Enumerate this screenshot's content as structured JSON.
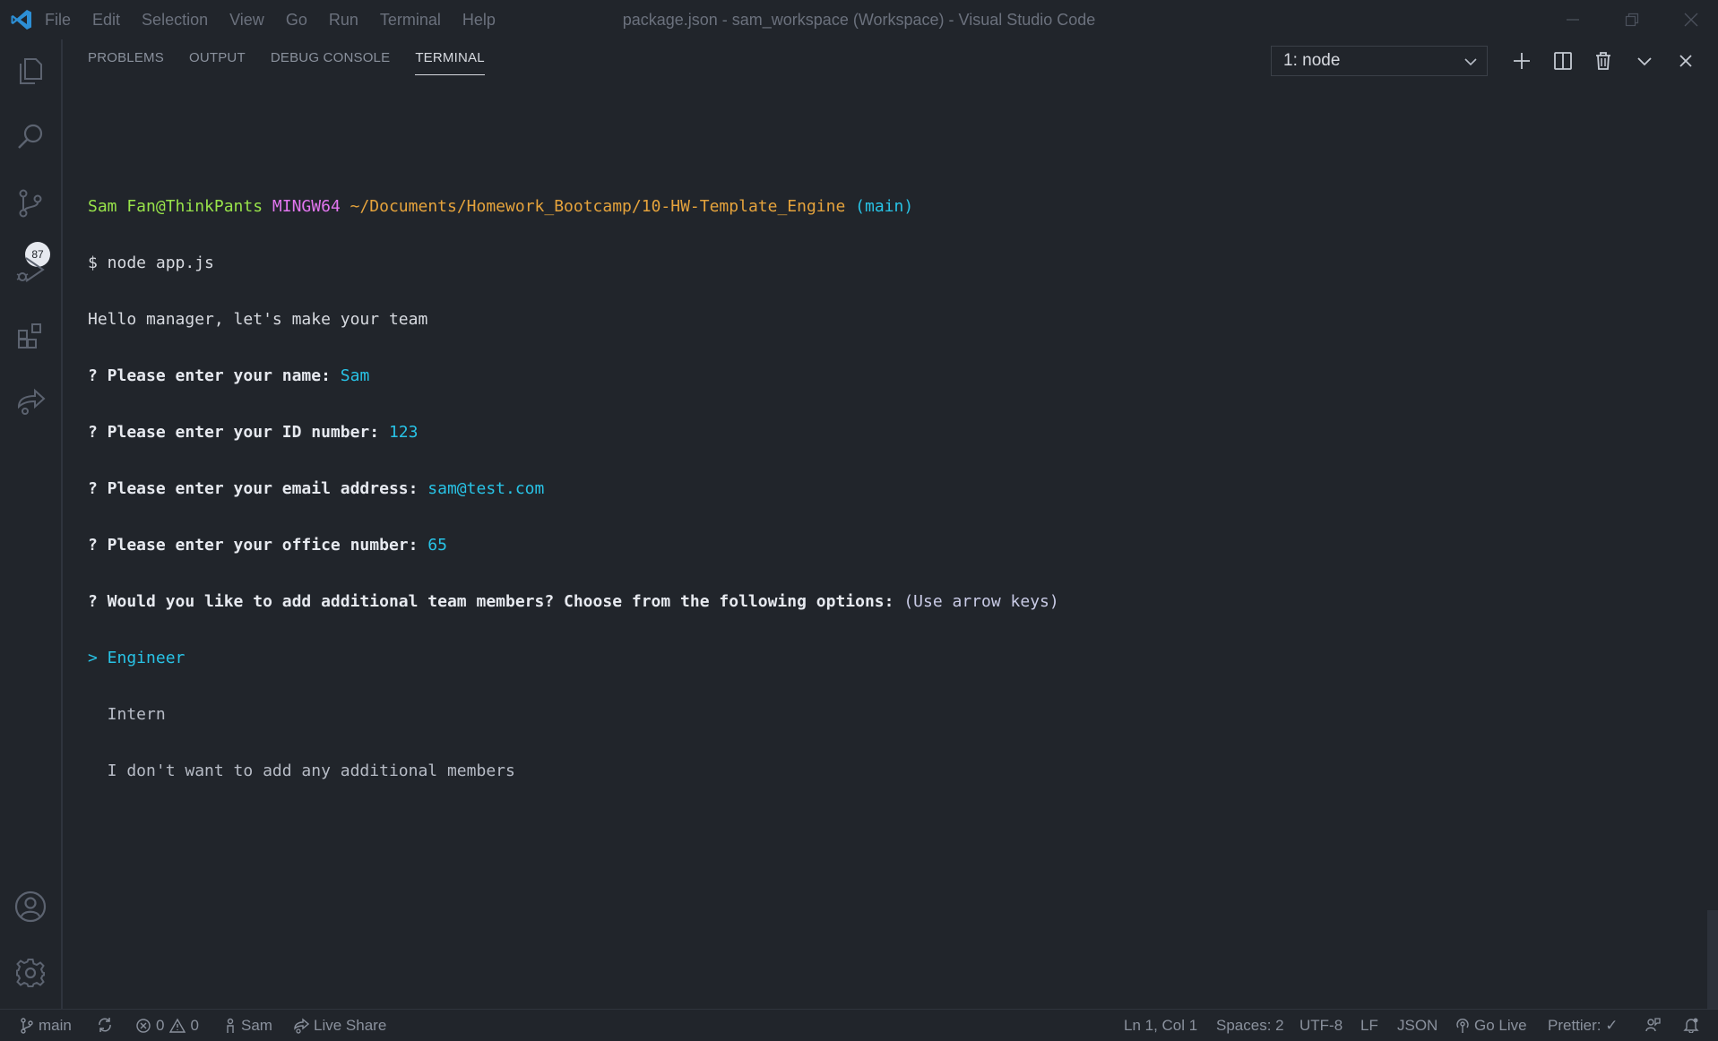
{
  "titlebar": {
    "menu": [
      "File",
      "Edit",
      "Selection",
      "View",
      "Go",
      "Run",
      "Terminal",
      "Help"
    ],
    "title": "package.json - sam_workspace (Workspace) - Visual Studio Code"
  },
  "activitybar": {
    "items": [
      "explorer-icon",
      "search-icon",
      "source-control-icon",
      "run-debug-icon",
      "extensions-icon",
      "live-share-icon"
    ],
    "scm_badge": "87",
    "bottom": [
      "account-icon",
      "settings-gear-icon"
    ]
  },
  "panel": {
    "tabs": [
      "PROBLEMS",
      "OUTPUT",
      "DEBUG CONSOLE",
      "TERMINAL"
    ],
    "active_tab": "TERMINAL",
    "terminal_select": "1: node",
    "actions": [
      "plus-icon",
      "split-icon",
      "trash-icon",
      "chevron-down-icon",
      "close-icon"
    ]
  },
  "terminal": {
    "prompt_user": "Sam Fan@ThinkPants",
    "prompt_env": "MINGW64",
    "prompt_path": "~/Documents/Homework_Bootcamp/10-HW-Template_Engine",
    "prompt_branch": "(main)",
    "command": "$ node app.js",
    "greeting": "Hello manager, let's make your team",
    "q1_label": "? Please enter your name: ",
    "q1_answer": "Sam",
    "q2_label": "? Please enter your ID number: ",
    "q2_answer": "123",
    "q3_label": "? Please enter your email address: ",
    "q3_answer": "sam@test.com",
    "q4_label": "? Please enter your office number: ",
    "q4_answer": "65",
    "q5_label": "? Would you like to add additional team members? Choose from the following options: ",
    "q5_hint": "(Use arrow keys)",
    "options": [
      "> Engineer",
      "  Intern",
      "  I don't want to add any additional members"
    ]
  },
  "statusbar": {
    "branch": "main",
    "errors": "0",
    "warnings": "0",
    "user": "Sam",
    "live_share": "Live Share",
    "cursor": "Ln 1, Col 1",
    "spaces": "Spaces: 2",
    "encoding": "UTF-8",
    "eol": "LF",
    "language": "JSON",
    "go_live": "Go Live",
    "prettier": "Prettier: ✓"
  },
  "colors": {
    "background": "#21252b",
    "accent_blue": "#3a9de0",
    "prompt_green": "#98e34a",
    "prompt_magenta": "#e376f0",
    "prompt_orange": "#e5a33c",
    "answer_cyan": "#28c3e6"
  }
}
